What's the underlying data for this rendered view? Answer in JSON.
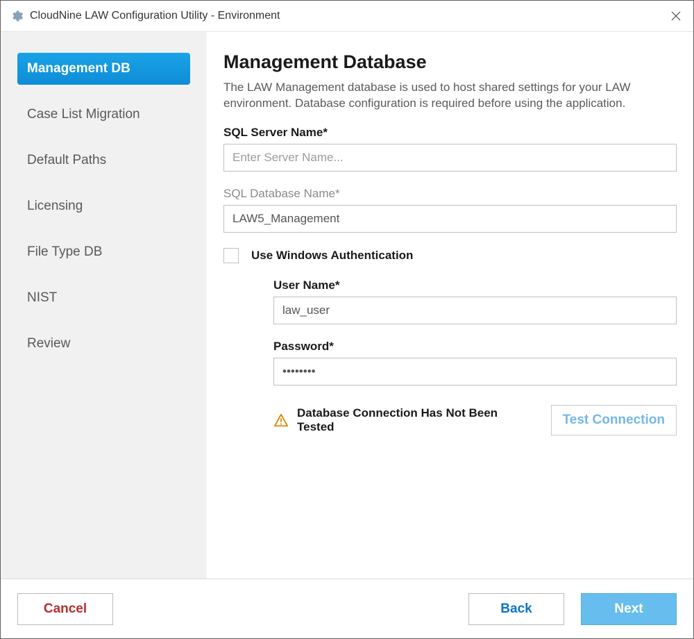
{
  "window": {
    "title": "CloudNine LAW Configuration Utility - Environment"
  },
  "sidebar": {
    "items": [
      {
        "label": "Management DB",
        "active": true
      },
      {
        "label": "Case List Migration",
        "active": false
      },
      {
        "label": "Default Paths",
        "active": false
      },
      {
        "label": "Licensing",
        "active": false
      },
      {
        "label": "File Type DB",
        "active": false
      },
      {
        "label": "NIST",
        "active": false
      },
      {
        "label": "Review",
        "active": false
      }
    ]
  },
  "main": {
    "heading": "Management Database",
    "description": "The LAW Management database is used to host shared settings for your LAW environment. Database configuration is required before using the application.",
    "sql_server_label": "SQL Server Name*",
    "sql_server_placeholder": "Enter Server Name...",
    "sql_server_value": "",
    "sql_db_label": "SQL Database Name*",
    "sql_db_value": "LAW5_Management",
    "win_auth_label": "Use Windows Authentication",
    "win_auth_checked": false,
    "username_label": "User Name*",
    "username_value": "law_user",
    "password_label": "Password*",
    "password_value": "••••••••",
    "status_text": "Database Connection Has Not Been Tested",
    "test_btn": "Test Connection"
  },
  "footer": {
    "cancel": "Cancel",
    "back": "Back",
    "next": "Next"
  }
}
